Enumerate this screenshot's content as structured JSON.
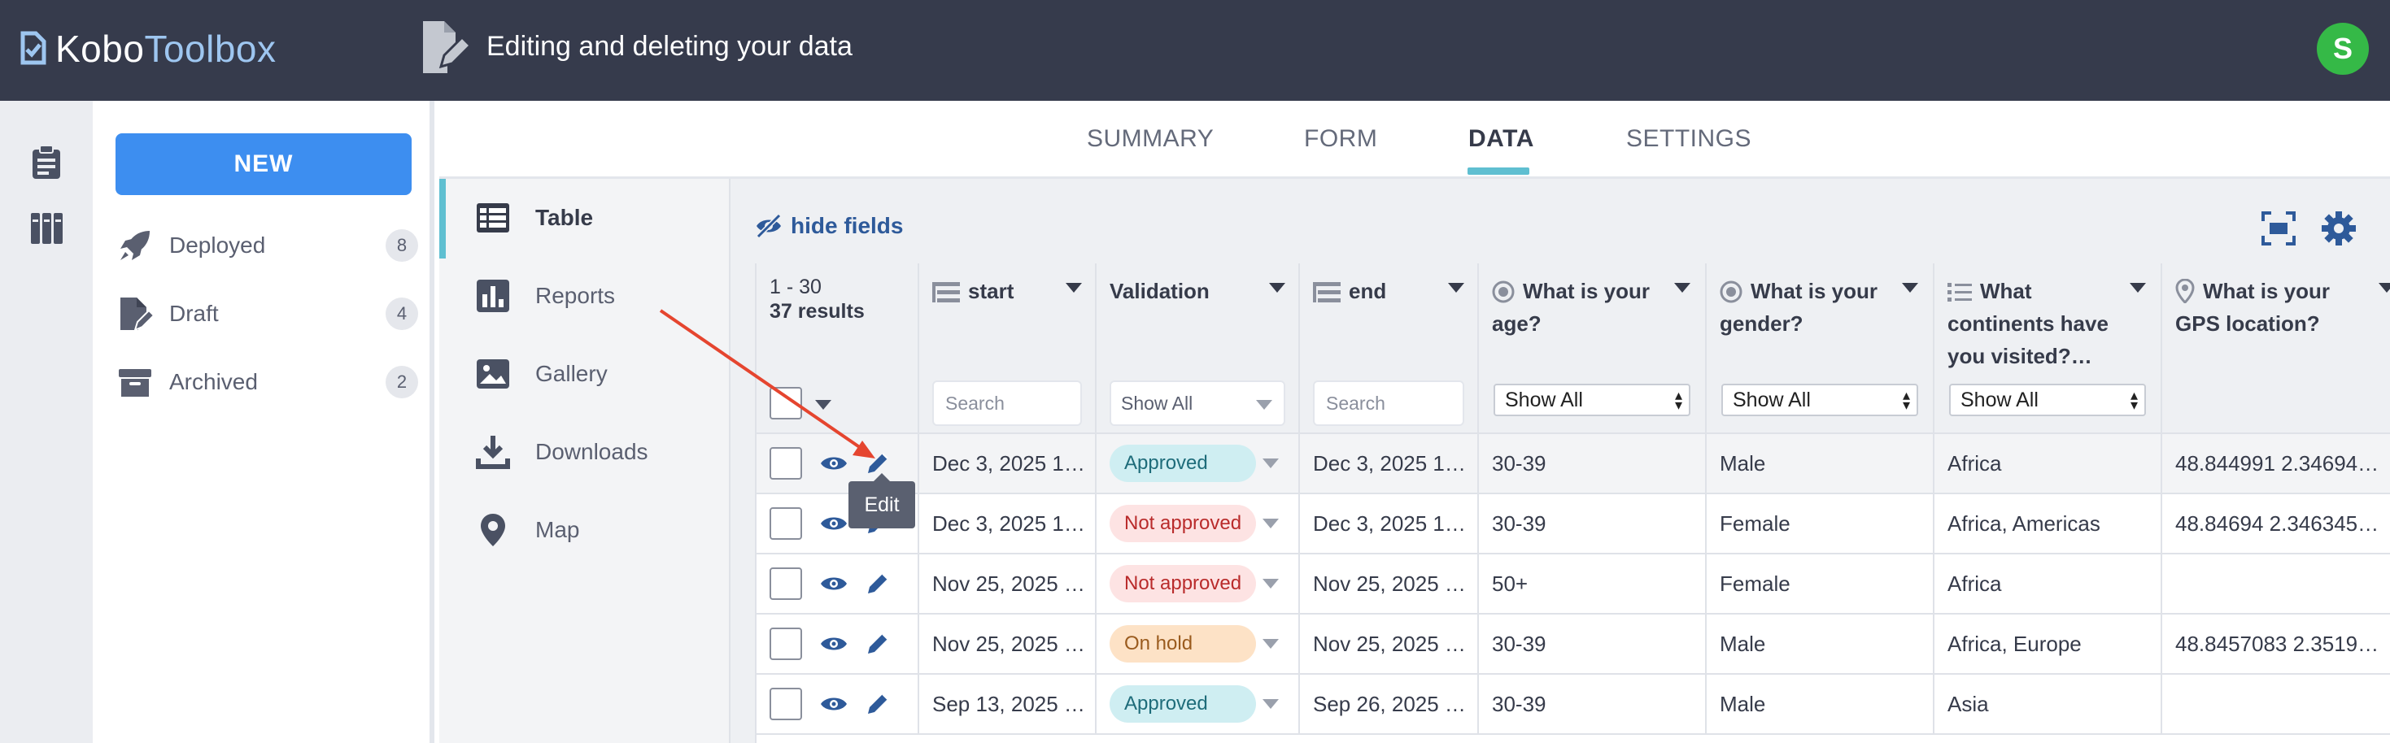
{
  "header": {
    "logo_kobo": "Kobo",
    "logo_toolbox": "Toolbox",
    "project_title": "Editing and deleting your data",
    "avatar_initial": "S"
  },
  "sidebar": {
    "new_button": "NEW",
    "items": [
      {
        "label": "Deployed",
        "count": "8",
        "icon": "rocket-icon"
      },
      {
        "label": "Draft",
        "count": "4",
        "icon": "draft-icon"
      },
      {
        "label": "Archived",
        "count": "2",
        "icon": "archive-icon"
      }
    ]
  },
  "tabs": [
    "SUMMARY",
    "FORM",
    "DATA",
    "SETTINGS"
  ],
  "active_tab": "DATA",
  "subnav": {
    "items": [
      "Table",
      "Reports",
      "Gallery",
      "Downloads",
      "Map"
    ],
    "active": "Table"
  },
  "toolbar": {
    "hide_fields": "hide fields"
  },
  "table": {
    "range": "1 - 30",
    "results": "37 results",
    "columns": {
      "start": "start",
      "validation": "Validation",
      "end": "end",
      "age_1": "What is your",
      "age_2": "age?",
      "gender_1": "What is your",
      "gender_2": "gender?",
      "continents_1": "What",
      "continents_2": "continents have",
      "continents_3": "you visited?…",
      "gps_1": "What is your",
      "gps_2": "GPS location?"
    },
    "search_placeholder": "Search",
    "show_all": "Show All",
    "rows": [
      {
        "start": "Dec 3, 2025 1…",
        "validation": "Approved",
        "status": "approved",
        "end": "Dec 3, 2025 1…",
        "age": "30-39",
        "gender": "Male",
        "continents": "Africa",
        "gps": "48.844991 2.34694…"
      },
      {
        "start": "Dec 3, 2025 1…",
        "validation": "Not approved",
        "status": "notapproved",
        "end": "Dec 3, 2025 1…",
        "age": "30-39",
        "gender": "Female",
        "continents": "Africa, Americas",
        "gps": "48.84694 2.346345…"
      },
      {
        "start": "Nov 25, 2025 …",
        "validation": "Not approved",
        "status": "notapproved",
        "end": "Nov 25, 2025 …",
        "age": "50+",
        "gender": "Female",
        "continents": "Africa",
        "gps": ""
      },
      {
        "start": "Nov 25, 2025 …",
        "validation": "On hold",
        "status": "onhold",
        "end": "Nov 25, 2025 …",
        "age": "30-39",
        "gender": "Male",
        "continents": "Africa, Europe",
        "gps": "48.8457083 2.3519…"
      },
      {
        "start": "Sep 13, 2025 …",
        "validation": "Approved",
        "status": "approved",
        "end": "Sep 26, 2025 …",
        "age": "30-39",
        "gender": "Male",
        "continents": "Asia",
        "gps": ""
      }
    ]
  },
  "tooltip": "Edit",
  "colors": {
    "topbar": "#363b4c",
    "accent": "#3d8ef0",
    "tab_underline": "#5fbfd1",
    "approved": "#cfeef2",
    "not_approved": "#fde3e3",
    "on_hold": "#fde2c6",
    "annotation_arrow": "#e5452f"
  }
}
